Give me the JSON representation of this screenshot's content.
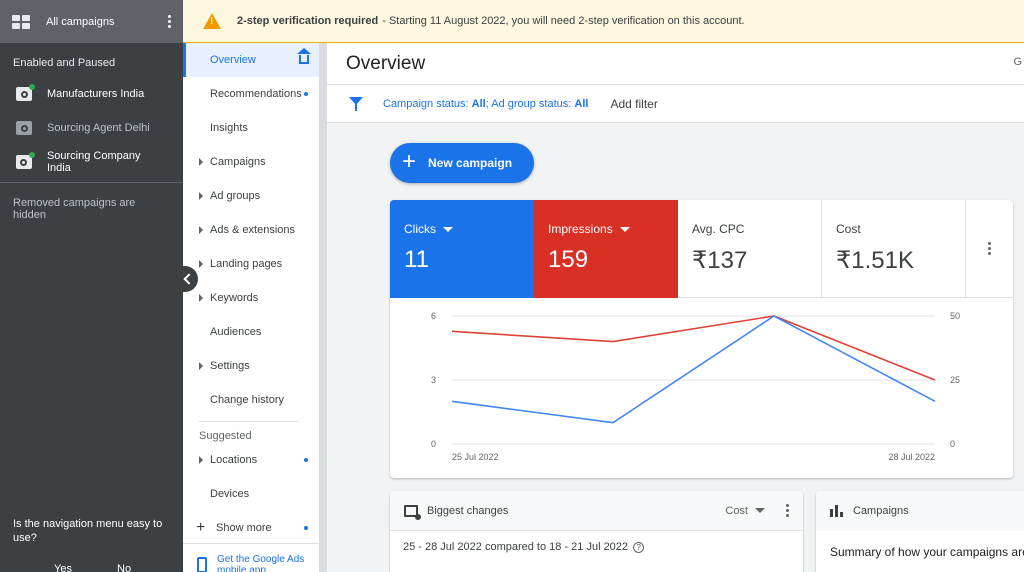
{
  "left_panel": {
    "title": "All campaigns",
    "section": "Enabled and Paused",
    "campaigns": [
      {
        "name": "Manufacturers India",
        "status": "enabled"
      },
      {
        "name": "Sourcing Agent Delhi",
        "status": "paused"
      },
      {
        "name": "Sourcing Company India",
        "status": "enabled"
      }
    ],
    "hidden_note": "Removed campaigns are hidden",
    "question": "Is the navigation menu easy to use?",
    "yes": "Yes",
    "no": "No"
  },
  "banner": {
    "bold": "2-step verification required",
    "text": "- Starting 11 August 2022, you will need 2-step verification on this account."
  },
  "nav": {
    "items": [
      {
        "label": "Overview"
      },
      {
        "label": "Recommendations"
      },
      {
        "label": "Insights"
      },
      {
        "label": "Campaigns"
      },
      {
        "label": "Ad groups"
      },
      {
        "label": "Ads & extensions"
      },
      {
        "label": "Landing pages"
      },
      {
        "label": "Keywords"
      },
      {
        "label": "Audiences"
      },
      {
        "label": "Settings"
      },
      {
        "label": "Change history"
      }
    ],
    "suggested_label": "Suggested",
    "suggested": [
      {
        "label": "Locations"
      },
      {
        "label": "Devices"
      }
    ],
    "show_more": "Show more",
    "app_link": "Get the Google Ads mobile app"
  },
  "header": {
    "title": "Overview",
    "edge_char": "G"
  },
  "filter": {
    "campaign_status_label": "Campaign status: ",
    "campaign_status_value": "All",
    "sep": "; ",
    "ad_group_label": "Ad group status: ",
    "ad_group_value": "All",
    "add_filter": "Add filter"
  },
  "new_campaign": "New campaign",
  "metrics": {
    "clicks": {
      "label": "Clicks",
      "value": "11"
    },
    "impressions": {
      "label": "Impressions",
      "value": "159"
    },
    "avg_cpc": {
      "label": "Avg. CPC",
      "value": "₹137"
    },
    "cost": {
      "label": "Cost",
      "value": "₹1.51K"
    }
  },
  "chart_data": {
    "type": "line",
    "x": [
      "25 Jul 2022",
      "26 Jul 2022",
      "27 Jul 2022",
      "28 Jul 2022"
    ],
    "x_tick_labels": [
      "25 Jul 2022",
      "28 Jul 2022"
    ],
    "series": [
      {
        "name": "Clicks",
        "axis": "left",
        "color": "#4285f4",
        "values": [
          2,
          1,
          6,
          2
        ]
      },
      {
        "name": "Impressions",
        "axis": "right",
        "color": "#db4437",
        "values": [
          44,
          40,
          50,
          25
        ]
      }
    ],
    "y_left": {
      "ticks": [
        "0",
        "3",
        "6"
      ],
      "range": [
        0,
        6
      ]
    },
    "y_right": {
      "ticks": [
        "0",
        "25",
        "50"
      ],
      "range": [
        0,
        50
      ]
    },
    "grid": true
  },
  "changes_card": {
    "title": "Biggest changes",
    "metric": "Cost",
    "range": "25 - 28 Jul 2022 compared to 18 - 21 Jul 2022",
    "help": "?"
  },
  "campaigns_card": {
    "title": "Campaigns",
    "summary": "Summary of how your campaigns are"
  }
}
